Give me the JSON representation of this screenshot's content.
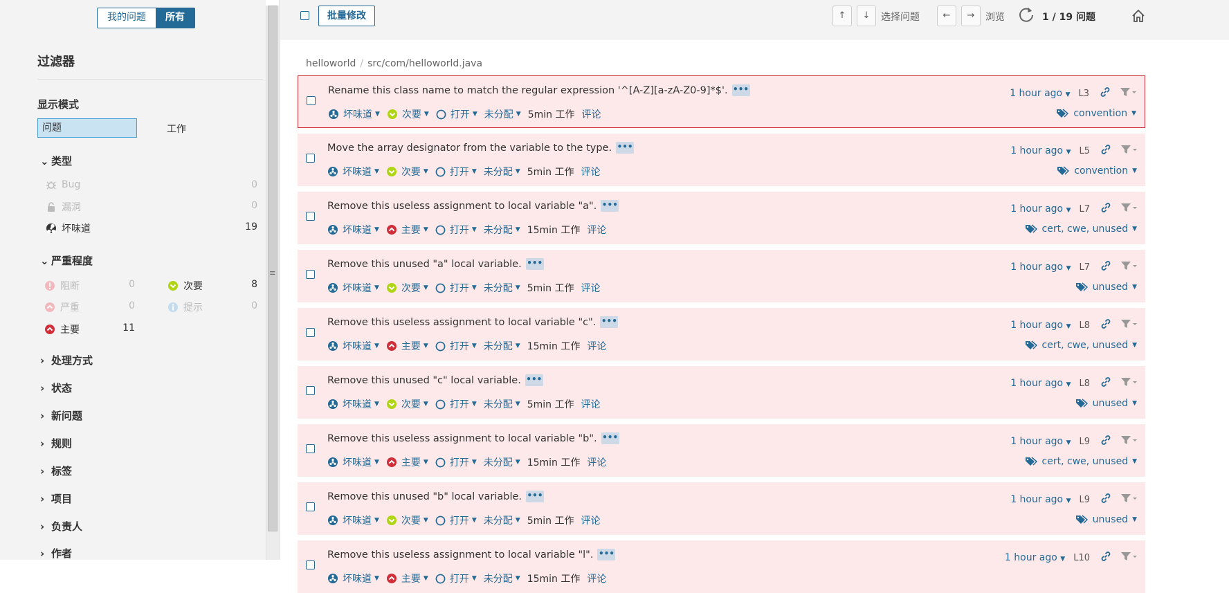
{
  "sidebar": {
    "toggle": {
      "my": "我的问题",
      "all": "所有"
    },
    "filter_title": "过滤器",
    "display_mode": {
      "title": "显示模式",
      "issues": "问题",
      "effort": "工作"
    },
    "type": {
      "title": "类型",
      "items": [
        {
          "label": "Bug",
          "count": "0"
        },
        {
          "label": "漏洞",
          "count": "0"
        },
        {
          "label": "坏味道",
          "count": "19"
        }
      ]
    },
    "severity": {
      "title": "严重程度",
      "items": [
        {
          "label": "阻断",
          "count": "0"
        },
        {
          "label": "次要",
          "count": "8"
        },
        {
          "label": "严重",
          "count": "0"
        },
        {
          "label": "提示",
          "count": "0"
        },
        {
          "label": "主要",
          "count": "11"
        }
      ]
    },
    "facets": [
      "处理方式",
      "状态",
      "新问题",
      "规则",
      "标签",
      "项目",
      "负责人",
      "作者"
    ]
  },
  "topbar": {
    "bulk_label": "批量修改",
    "up_key": "↑",
    "down_key": "↓",
    "select_label": "选择问题",
    "left_key": "←",
    "right_key": "→",
    "browse_label": "浏览",
    "counter": "1 / 19 问题"
  },
  "breadcrumb": {
    "project": "helloworld",
    "file": "src/com/helloworld.java"
  },
  "labels": {
    "type": "坏味道",
    "status": "打开",
    "assignee": "未分配",
    "comment": "评论",
    "work_suffix": "工作"
  },
  "issues": [
    {
      "message": "Rename this class name to match the regular expression '^[A-Z][a-zA-Z0-9]*$'.",
      "severity": "次要",
      "sev": "minor",
      "effort": "5min",
      "age": "1 hour ago",
      "line": "L3",
      "tags": "convention"
    },
    {
      "message": "Move the array designator from the variable to the type.",
      "severity": "次要",
      "sev": "minor",
      "effort": "5min",
      "age": "1 hour ago",
      "line": "L5",
      "tags": "convention"
    },
    {
      "message": "Remove this useless assignment to local variable \"a\".",
      "severity": "主要",
      "sev": "major",
      "effort": "15min",
      "age": "1 hour ago",
      "line": "L7",
      "tags": "cert, cwe, unused"
    },
    {
      "message": "Remove this unused \"a\" local variable.",
      "severity": "次要",
      "sev": "minor",
      "effort": "5min",
      "age": "1 hour ago",
      "line": "L7",
      "tags": "unused"
    },
    {
      "message": "Remove this useless assignment to local variable \"c\".",
      "severity": "主要",
      "sev": "major",
      "effort": "15min",
      "age": "1 hour ago",
      "line": "L8",
      "tags": "cert, cwe, unused"
    },
    {
      "message": "Remove this unused \"c\" local variable.",
      "severity": "次要",
      "sev": "minor",
      "effort": "5min",
      "age": "1 hour ago",
      "line": "L8",
      "tags": "unused"
    },
    {
      "message": "Remove this useless assignment to local variable \"b\".",
      "severity": "主要",
      "sev": "major",
      "effort": "15min",
      "age": "1 hour ago",
      "line": "L9",
      "tags": "cert, cwe, unused"
    },
    {
      "message": "Remove this unused \"b\" local variable.",
      "severity": "次要",
      "sev": "minor",
      "effort": "5min",
      "age": "1 hour ago",
      "line": "L9",
      "tags": "unused"
    },
    {
      "message": "Remove this useless assignment to local variable \"l\".",
      "severity": "主要",
      "sev": "major",
      "effort": "15min",
      "age": "1 hour ago",
      "line": "L10",
      "tags": ""
    }
  ],
  "colors": {
    "accent": "#236a97",
    "minor": "#b0d513",
    "major": "#d02f3a",
    "issue_bg": "#fde9e9"
  }
}
